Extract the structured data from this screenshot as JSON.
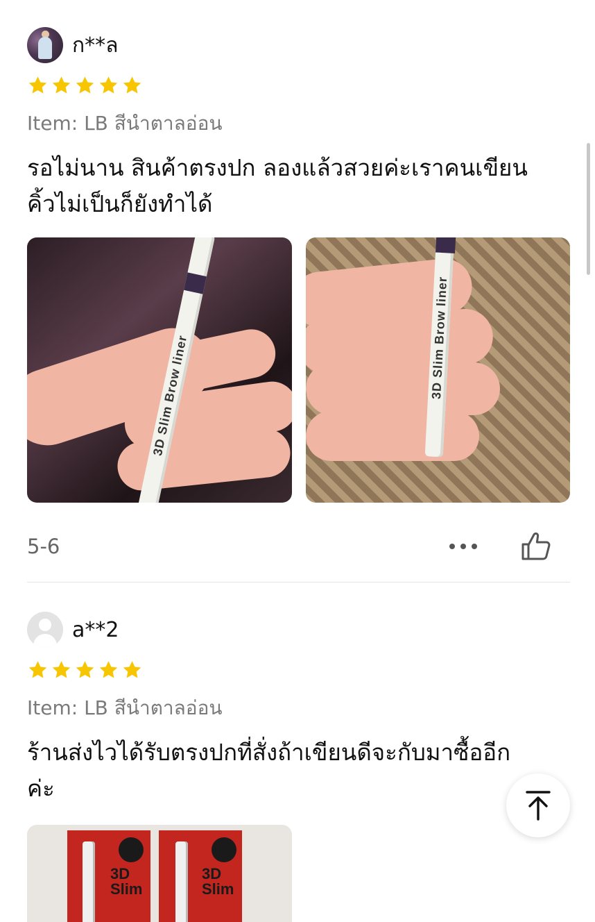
{
  "colors": {
    "star": "#F7C600",
    "muted_text": "#7a7a7a",
    "divider": "#e4e4e4"
  },
  "reviews": [
    {
      "username": "ก**ล",
      "avatar": "user-photo-avatar",
      "rating": 5,
      "item": "Item: LB สีนำตาลอ่อน",
      "text_line1": "รอไม่นาน สินค้าตรงปก ลองแล้วสวยค่ะเราคนเขียน",
      "text_line2": "คิ้วไม่เป็นก็ยังทำได้",
      "photo_labels": [
        "3D Slim Brow liner",
        "3D Slim Brow liner"
      ],
      "date": "5-6"
    },
    {
      "username": "a**2",
      "avatar": "default-avatar",
      "rating": 5,
      "item": "Item: LB สีนำตาลอ่อน",
      "text_line1": "ร้านส่งไวได้รับตรงปกที่สั่งถ้าเขียนดีจะกับมาซื้ออีก",
      "text_line2": "ค่ะ",
      "card_labels": [
        "3D",
        "Slim",
        "3D",
        "Slim"
      ]
    }
  ],
  "icons": {
    "more": "more-dots-icon",
    "like": "thumbs-up-icon",
    "scroll_top": "arrow-up-to-top-icon"
  }
}
